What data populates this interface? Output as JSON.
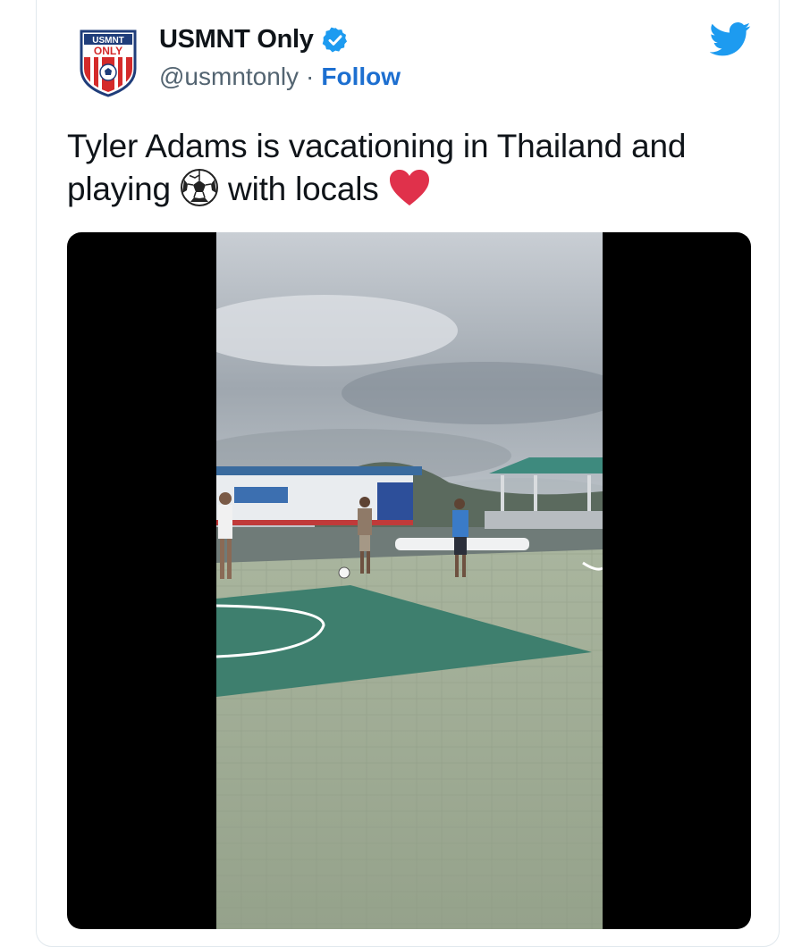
{
  "author": {
    "display_name": "USMNT Only",
    "handle": "@usmntonly",
    "separator": "·",
    "follow_label": "Follow",
    "avatar_text_top": "USMNT",
    "avatar_text_bottom": "ONLY"
  },
  "tweet": {
    "text_line1": "Tyler Adams is vacationing in Thailand and",
    "text_line2_before": "playing",
    "text_line2_after": "with locals"
  },
  "icons": {
    "verified": "verified-badge-icon",
    "platform": "twitter-bird-icon",
    "ball": "soccer-ball-emoji",
    "heart": "red-heart-emoji"
  },
  "colors": {
    "accent": "#1d9bf0",
    "follow": "#1d6fd0",
    "text": "#0f1419",
    "secondary": "#536471",
    "heart": "#e0314b"
  }
}
